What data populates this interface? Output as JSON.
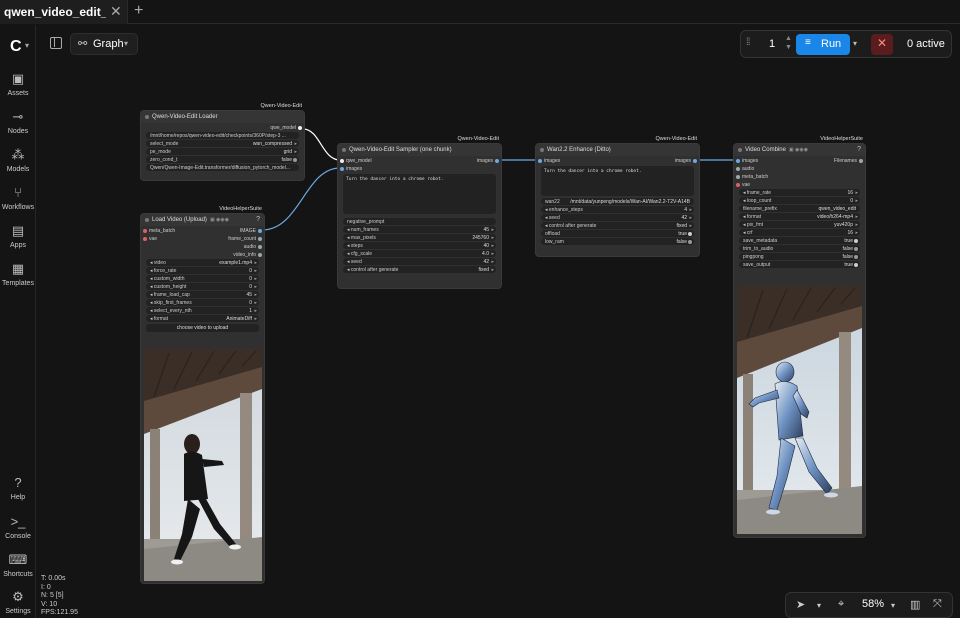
{
  "tab": {
    "title": "qwen_video_edit_ch...",
    "close": "✕",
    "add": "+"
  },
  "sidebar": {
    "items": [
      {
        "label": "Assets",
        "icon": "assets-icon"
      },
      {
        "label": "Nodes",
        "icon": "nodes-icon"
      },
      {
        "label": "Models",
        "icon": "models-icon"
      },
      {
        "label": "Workflows",
        "icon": "workflows-icon"
      },
      {
        "label": "Apps",
        "icon": "apps-icon"
      },
      {
        "label": "Templates",
        "icon": "templates-icon"
      }
    ],
    "bottom": [
      {
        "label": "Help"
      },
      {
        "label": "Console"
      },
      {
        "label": "Shortcuts"
      },
      {
        "label": "Settings"
      }
    ]
  },
  "stats": {
    "t": "T: 0.00s",
    "i": "I: 0",
    "n": "N: 5 [5]",
    "v": "V: 10",
    "fps": "FPS:121.95"
  },
  "graph": {
    "label": "Graph"
  },
  "run": {
    "batch": "1",
    "label": "Run",
    "active": "0 active"
  },
  "bottombar": {
    "zoom": "58%"
  },
  "nodes": {
    "loader": {
      "tag": "Qwen-Video-Edit",
      "title": "Qwen-Video-Edit Loader",
      "output": "qwe_model",
      "path": "/mnt/home/repos/qwen-video-edit/checkpoints/360P/step-3 ...",
      "select_mode_label": "select_mode",
      "select_mode_value": "wan_compressed",
      "pe_mode_label": "pe_mode",
      "pe_mode_value": "grid",
      "zero_cond_label": "zero_cond_t",
      "zero_cond_value": "false",
      "transformer": "Qwen/Qwen-Image-Edit.transformer/diffusion_pytorch_model..."
    },
    "load_video": {
      "tag": "VideoHelperSuite",
      "title": "Load Video (Upload)",
      "inputs": [
        "meta_batch",
        "vae"
      ],
      "outputs": [
        "IMAGE",
        "frame_count",
        "audio",
        "video_info"
      ],
      "widgets": [
        {
          "label": "video",
          "value": "example1.mp4"
        },
        {
          "label": "force_rate",
          "value": "0"
        },
        {
          "label": "custom_width",
          "value": "0"
        },
        {
          "label": "custom_height",
          "value": "0"
        },
        {
          "label": "frame_load_cap",
          "value": "45"
        },
        {
          "label": "skip_first_frames",
          "value": "0"
        },
        {
          "label": "select_every_nth",
          "value": "1"
        },
        {
          "label": "format",
          "value": "AnimateDiff"
        }
      ],
      "upload": "choose video to upload"
    },
    "sampler": {
      "tag": "Qwen-Video-Edit",
      "title": "Qwen-Video-Edit Sampler (one chunk)",
      "inputs": [
        "qwe_model",
        "images"
      ],
      "output": "images",
      "prompt": "Turn the dancer into a chrome robot.",
      "negative": "negative_prompt",
      "widgets": [
        {
          "label": "num_frames",
          "value": "45"
        },
        {
          "label": "max_pixels",
          "value": "245760"
        },
        {
          "label": "steps",
          "value": "40"
        },
        {
          "label": "cfg_scale",
          "value": "4.0"
        },
        {
          "label": "seed",
          "value": "42"
        },
        {
          "label": "control after generate",
          "value": "fixed"
        }
      ]
    },
    "enhance": {
      "tag": "Qwen-Video-Edit",
      "title": "Wan2.2 Enhance (Ditto)",
      "input": "images",
      "output": "images",
      "prompt": "Turn the dancer into a chrome robot.",
      "model_label": "wan22",
      "model_path": "/mnt/data/yunpeng/models/Wan-AI/Wan2.2-T2V-A14B",
      "widgets": [
        {
          "label": "enhance_steps",
          "value": "4"
        },
        {
          "label": "seed",
          "value": "42"
        },
        {
          "label": "control after generate",
          "value": "fixed"
        }
      ],
      "toggles": [
        {
          "label": "offload",
          "value": "true"
        },
        {
          "label": "low_ram",
          "value": "false"
        }
      ]
    },
    "combine": {
      "tag": "VideoHelperSuite",
      "title": "Video Combine",
      "inputs": [
        "images",
        "audio",
        "meta_batch",
        "vae"
      ],
      "output": "Filenames",
      "widgets": [
        {
          "label": "frame_rate",
          "value": "16"
        },
        {
          "label": "loop_count",
          "value": "0"
        },
        {
          "label": "filename_prefix",
          "value": "qwen_video_edit"
        },
        {
          "label": "format",
          "value": "video/h264-mp4"
        },
        {
          "label": "pix_fmt",
          "value": "yuv420p"
        },
        {
          "label": "crf",
          "value": "16"
        }
      ],
      "toggles": [
        {
          "label": "save_metadata",
          "value": "true"
        },
        {
          "label": "trim_to_audio",
          "value": "false"
        },
        {
          "label": "pingpong",
          "value": "false"
        },
        {
          "label": "save_output",
          "value": "true"
        }
      ]
    }
  },
  "colors": {
    "accent": "#1a86e8",
    "wire": "#6aa9e6",
    "node_bg": "#303030",
    "canvas": "#141414",
    "stop": "#5a1c1c"
  }
}
